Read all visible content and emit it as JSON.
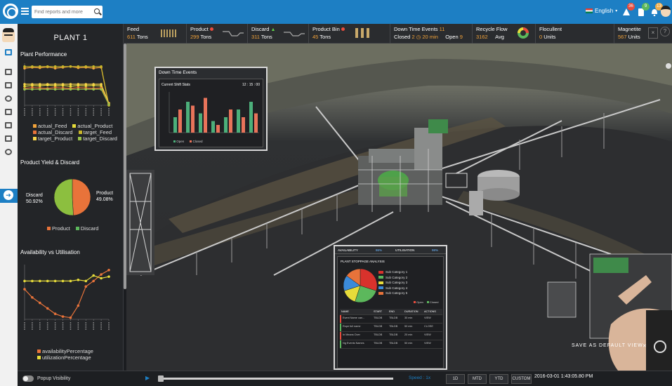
{
  "header": {
    "search_placeholder": "Find reports and more",
    "language": "English",
    "badges": {
      "alerts": "36",
      "tasks": "9",
      "notifications": "13"
    }
  },
  "colors": {
    "brand": "#1d7fc4",
    "accent_orange": "#f2a33a",
    "green": "#5cb85c",
    "red": "#e84c3d",
    "yellow": "#e7dc3a"
  },
  "left_panel": {
    "plant_title": "PLANT 1",
    "plant_performance": {
      "title": "Plant Performance",
      "legend": [
        "actual_Feed",
        "actual_Product",
        "actual_Discard",
        "target_Feed",
        "target_Product",
        "target_Discard"
      ]
    },
    "yield": {
      "title": "Product Yield & Discard",
      "discard_label": "Discard",
      "discard_value": "50.92%",
      "product_label": "Product",
      "product_value": "49.08%",
      "legend": [
        "Product",
        "Discard"
      ]
    },
    "availability": {
      "title": "Availability vs Utilisation",
      "legend": [
        "availabilityPercentage",
        "utilizationPercentage"
      ]
    }
  },
  "kpis": [
    {
      "label": "Feed",
      "value": "611",
      "unit": "Tons"
    },
    {
      "label": "Product",
      "value": "299",
      "unit": "Tons"
    },
    {
      "label": "Discard",
      "value": "311",
      "unit": "Tons"
    },
    {
      "label": "Product Bin",
      "value": "45",
      "unit": "Tons"
    },
    {
      "label": "Down Time Events",
      "count": "11",
      "closed_label": "Closed",
      "closed_value": "2",
      "duration": "20 min",
      "open_label": "Open",
      "open_value": "9"
    },
    {
      "label": "Recycle Flow",
      "value": "3162",
      "avg_label": "Avg"
    },
    {
      "label": "Flocullent",
      "value": "0",
      "unit": "Units"
    },
    {
      "label": "Magnetite",
      "value": "567",
      "unit": "Units"
    }
  ],
  "downtime_popup": {
    "title": "Down Time Events",
    "subtitle": "Current Shift Stats",
    "time": "12 : 15 : 00",
    "legend_open": "Open",
    "legend_closed": "Closed"
  },
  "stoppage_popup": {
    "availability_label": "AVAILABILITY",
    "availability_value": "86%",
    "utilisation_label": "UTILISATION",
    "utilisation_value": "98%",
    "title": "PLANT STOPPAGE ANALYSIS",
    "categories": [
      "Sub Category 1",
      "Sub Category 2",
      "Sub Category 3",
      "Sub Category 4",
      "Sub Category 5"
    ],
    "legend_open": "Open",
    "legend_closed": "Closed",
    "table_headers": [
      "NAME",
      "START",
      "END",
      "DURATION",
      "ACTIONS"
    ],
    "rows": [
      [
        "Event Name can...",
        "TBLDB",
        "TBLDB",
        "30 min",
        "VIEW"
      ],
      [
        "Rope full name",
        "TBLDB",
        "TBLDB",
        "50 min",
        "CLOSE"
      ],
      [
        "In Means Over",
        "TBLDB",
        "TBLDB",
        "20 min",
        "VIEW"
      ],
      [
        "Ng Events Names",
        "TBLDB",
        "TBLDB",
        "50 min",
        "VIEW"
      ]
    ]
  },
  "scene": {
    "save_default_view": "SAVE AS DEFAULT VIEW"
  },
  "bottom": {
    "popup_visibility": "Popup Visibility",
    "speed": "Speed : 1x",
    "buttons": [
      "1D",
      "MTD",
      "YTD",
      "CUSTOM"
    ],
    "timestamp": "2016-03-01 1:43:05.80 PM"
  },
  "chart_data": [
    {
      "type": "line",
      "title": "Plant Performance",
      "series": [
        {
          "name": "actual_Feed",
          "values": [
            88,
            90,
            89,
            91,
            88,
            90,
            92,
            89,
            90,
            88,
            90,
            0
          ]
        },
        {
          "name": "target_Feed",
          "values": [
            92,
            92,
            92,
            92,
            92,
            92,
            92,
            92,
            92,
            92,
            92,
            0
          ]
        },
        {
          "name": "actual_Product",
          "values": [
            45,
            47,
            46,
            48,
            46,
            47,
            45,
            47,
            46,
            47,
            46,
            5
          ]
        },
        {
          "name": "target_Product",
          "values": [
            50,
            50,
            50,
            50,
            50,
            50,
            50,
            50,
            50,
            50,
            50,
            5
          ]
        },
        {
          "name": "actual_Discard",
          "values": [
            40,
            42,
            41,
            40,
            42,
            41,
            40,
            42,
            41,
            40,
            41,
            3
          ]
        },
        {
          "name": "target_Discard",
          "values": [
            38,
            38,
            38,
            38,
            38,
            38,
            38,
            38,
            38,
            38,
            38,
            2
          ]
        }
      ],
      "ylim": [
        0,
        100
      ]
    },
    {
      "type": "pie",
      "title": "Product Yield & Discard",
      "slices": [
        {
          "name": "Product",
          "value": 49.08
        },
        {
          "name": "Discard",
          "value": 50.92
        }
      ]
    },
    {
      "type": "line",
      "title": "Availability vs Utilisation",
      "series": [
        {
          "name": "availabilityPercentage",
          "values": [
            55,
            40,
            30,
            20,
            10,
            5,
            3,
            25,
            60,
            70,
            82,
            90
          ]
        },
        {
          "name": "utilizationPercentage",
          "values": [
            70,
            70,
            70,
            70,
            70,
            70,
            70,
            72,
            70,
            80,
            75,
            78
          ]
        }
      ],
      "ylim": [
        0,
        100
      ]
    },
    {
      "type": "bar",
      "title": "Down Time Events",
      "series": [
        {
          "name": "Open",
          "values": [
            4,
            8,
            5,
            3,
            4,
            6,
            8
          ]
        },
        {
          "name": "Closed",
          "values": [
            6,
            7,
            9,
            2,
            6,
            4,
            5
          ]
        }
      ]
    },
    {
      "type": "pie",
      "title": "PLANT STOPPAGE ANALYSIS",
      "slices": [
        {
          "name": "Sub Category 1",
          "value": 30
        },
        {
          "name": "Sub Category 2",
          "value": 25
        },
        {
          "name": "Sub Category 3",
          "value": 15
        },
        {
          "name": "Sub Category 4",
          "value": 15
        },
        {
          "name": "Sub Category 5",
          "value": 15
        }
      ]
    }
  ]
}
